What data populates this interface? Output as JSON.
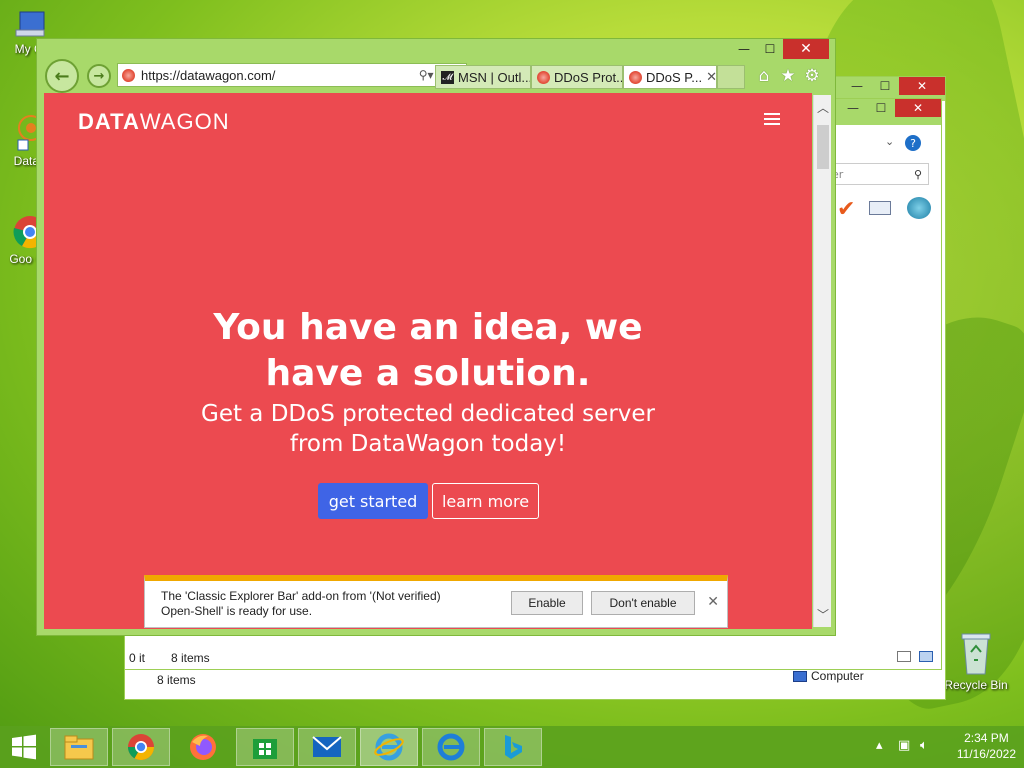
{
  "desktop": {
    "icons": [
      {
        "label": "My Co"
      },
      {
        "label": "DataW"
      },
      {
        "label": "Goo Chr"
      },
      {
        "label": "Recycle Bin"
      }
    ]
  },
  "explorer_back": {
    "search_placeholder": "er",
    "status_items": "8 items",
    "status_items_top": "0 it",
    "status_items_inner": "8 items",
    "status_location": "Computer"
  },
  "browser": {
    "address": "https://datawagon.com/",
    "tabs": [
      {
        "label": "MSN | Outl...",
        "icon": "msn-icon",
        "active": false
      },
      {
        "label": "DDoS Prot...",
        "icon": "favicon",
        "active": false
      },
      {
        "label": "DDoS P...",
        "icon": "favicon",
        "active": true
      }
    ],
    "caption": {
      "minimize": "—",
      "maximize": "☐",
      "close": "✕"
    }
  },
  "page": {
    "logo_bold": "DATA",
    "logo_light": "WAGON",
    "headline_line1": "You have an idea, we",
    "headline_line2": "have a solution.",
    "sub_line1": "Get a DDoS protected dedicated server",
    "sub_line2": "from DataWagon today!",
    "primary_button": "get started",
    "secondary_button": "learn more",
    "colors": {
      "background": "#ec4a50",
      "primary": "#3f64e6"
    }
  },
  "notification": {
    "line1": "The 'Classic Explorer Bar' add-on from '(Not verified)",
    "line2": "Open-Shell' is ready for use.",
    "enable": "Enable",
    "dont_enable": "Don't enable",
    "close": "✕"
  },
  "taskbar": {
    "time": "2:34 PM",
    "date": "11/16/2022"
  }
}
